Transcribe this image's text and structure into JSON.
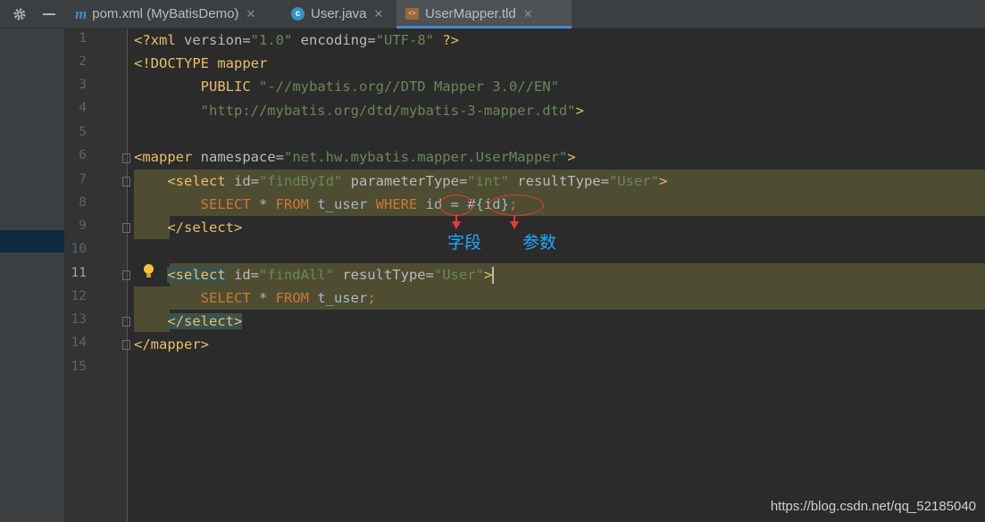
{
  "toolbar": {
    "settings_icon": "gear-icon",
    "minimize_icon": "minus-icon"
  },
  "tabs": [
    {
      "icon": "maven-m-icon",
      "label": "pom.xml (MyBatisDemo)",
      "close": "✕",
      "active": false
    },
    {
      "icon": "java-class-icon",
      "label": "User.java",
      "close": "✕",
      "active": false
    },
    {
      "icon": "tld-file-icon",
      "label": "UserMapper.tld",
      "close": "✕",
      "active": true
    }
  ],
  "editor": {
    "line_numbers": [
      "1",
      "2",
      "3",
      "4",
      "5",
      "6",
      "7",
      "8",
      "9",
      "10",
      "11",
      "12",
      "13",
      "14",
      "15"
    ],
    "current_line": "11",
    "lines": {
      "l1": {
        "open": "<?xml",
        "a1": " version=",
        "v1": "\"1.0\"",
        "a2": " encoding=",
        "v2": "\"UTF-8\"",
        "close": " ?>"
      },
      "l2": {
        "text": "<!DOCTYPE mapper"
      },
      "l3": {
        "indent": "        ",
        "kw": "PUBLIC",
        "val": " \"-//mybatis.org//DTD Mapper 3.0//EN\""
      },
      "l4": {
        "indent": "        ",
        "val": "\"http://mybatis.org/dtd/mybatis-3-mapper.dtd\"",
        "close": ">"
      },
      "l6": {
        "open": "<mapper",
        "a1": " namespace=",
        "v1": "\"net.hw.mybatis.mapper.UserMapper\"",
        "close": ">"
      },
      "l7": {
        "indent": "    ",
        "open": "<select",
        "a1": " id=",
        "v1": "\"findById\"",
        "a2": " parameterType=",
        "v2": "\"int\"",
        "a3": " resultType=",
        "v3": "\"User\"",
        "close": ">"
      },
      "l8": {
        "indent": "        ",
        "k1": "SELECT",
        "p1": " * ",
        "k2": "FROM",
        "p2": " t_user ",
        "k3": "WHERE",
        "p3": " id = #{id}",
        "semi": ";"
      },
      "l9": {
        "indent": "    ",
        "close": "</select>"
      },
      "l11": {
        "indent": "    ",
        "open": "<select",
        "a1": " id=",
        "v1": "\"findAll\"",
        "a2": " resultType=",
        "v2": "\"User\"",
        "close": ">"
      },
      "l12": {
        "indent": "        ",
        "k1": "SELECT",
        "p1": " * ",
        "k2": "FROM",
        "p2": " t_user",
        "semi": ";"
      },
      "l13": {
        "indent": "    ",
        "close": "</select>"
      },
      "l14": {
        "close": "</mapper>"
      }
    }
  },
  "annotations": {
    "field_label": "字段",
    "param_label": "参数"
  },
  "watermark": "https://blog.csdn.net/qq_52185040",
  "colors": {
    "tag": "#e8bf6a",
    "string": "#6a8759",
    "keyword": "#cc7832",
    "highlight": "#4e4d32",
    "annotation": "#1fa9ff",
    "ellipse": "#e23b3b"
  }
}
